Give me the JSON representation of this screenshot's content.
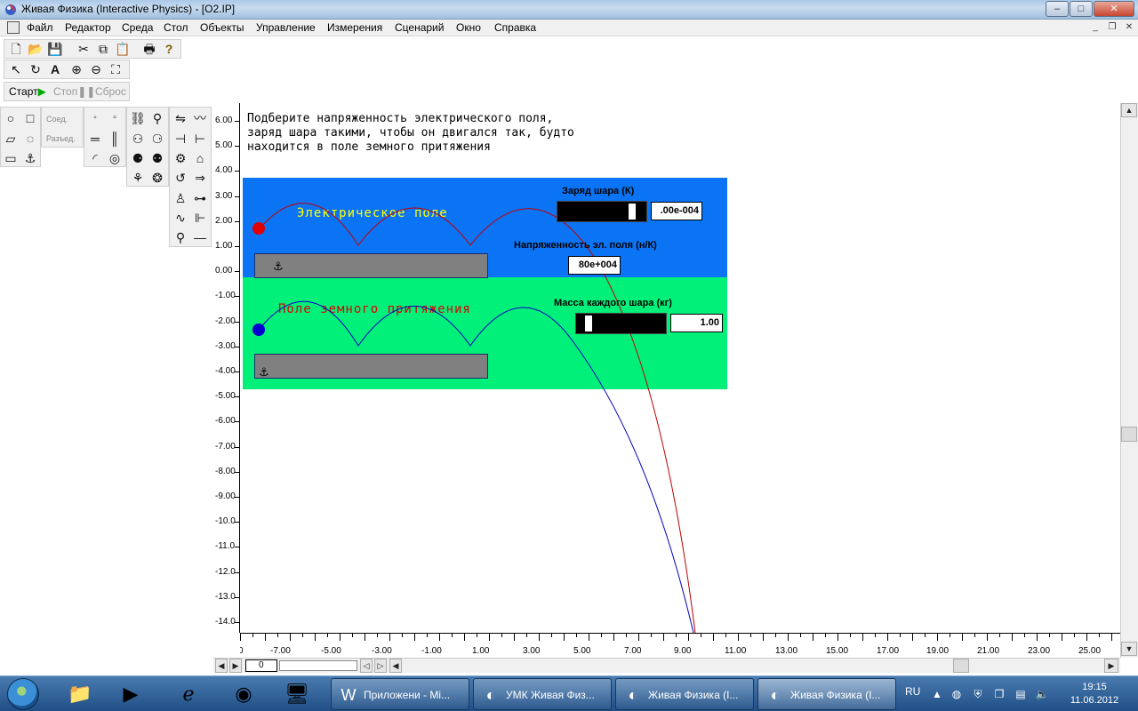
{
  "window": {
    "title": "Живая Физика (Interactive Physics) - [O2.IP]",
    "controls": {
      "minimize": "–",
      "maximize": "□",
      "close": "✕"
    }
  },
  "menubar": {
    "items": [
      "Файл",
      "Редактор",
      "Среда",
      "Стол",
      "Объекты",
      "Управление",
      "Измерения",
      "Сценарий",
      "Окно",
      "Справка"
    ],
    "mdi_controls": {
      "minimize": "_",
      "restore": "❐",
      "close": "✕"
    }
  },
  "controls": {
    "start": "Старт",
    "stop": "Стоп",
    "reset": "Сброс"
  },
  "palette": {
    "join": "Соед.",
    "split": "Разъед."
  },
  "canvas": {
    "instruction": [
      "Подберите напряженность электрического поля,",
      "заряд шара такими, чтобы он двигался так, будто",
      "находится в поле земного притяжения"
    ],
    "electric_field_label": "Электрическое поле",
    "gravity_field_label": "Поле земного притяжения",
    "charge": {
      "label": "Заряд шара (К)",
      "value": ".00e-004",
      "slider_fraction": 0.9
    },
    "field_strength": {
      "label": "Напряженность эл. поля (н/К)",
      "value": "80e+004"
    },
    "mass": {
      "label": "Масса каждого шара (кг)",
      "value": "1.00",
      "slider_fraction": 0.1
    },
    "colors": {
      "electric_panel": "#0a74f5",
      "gravity_panel": "#00f07a",
      "red_ball": "#e00000",
      "blue_ball": "#0000d0",
      "electric_label": "#ffff00",
      "gravity_label": "#e00000"
    },
    "y_ruler": [
      "6.00",
      "5.00",
      "4.00",
      "3.00",
      "2.00",
      "1.00",
      "0.00",
      "-1.00",
      "-2.00",
      "-3.00",
      "-4.00",
      "-5.00",
      "-6.00",
      "-7.00",
      "-8.00",
      "-9.00",
      "-10.0",
      "-11.0",
      "-12.0",
      "-13.0",
      "-14.0"
    ],
    "x_ruler": [
      "0",
      "-7.00",
      "-5.00",
      "-3.00",
      "-1.00",
      "1.00",
      "3.00",
      "5.00",
      "7.00",
      "9.00",
      "11.00",
      "13.00",
      "15.00",
      "17.00",
      "19.00",
      "21.00",
      "23.00",
      "25.00"
    ],
    "frame_counter": "0"
  },
  "taskbar": {
    "pinned": [
      "explorer-icon",
      "media-player-icon",
      "internet-explorer-icon",
      "chrome-icon",
      "remote-desktop-icon"
    ],
    "buttons": [
      {
        "label": "Приложени - Mi...",
        "icon": "word-icon"
      },
      {
        "label": "УМК Живая Физ...",
        "icon": "interactive-physics-icon"
      },
      {
        "label": "Живая Физика (I...",
        "icon": "interactive-physics-icon"
      },
      {
        "label": "Живая Физика (I...",
        "icon": "interactive-physics-icon"
      }
    ],
    "language": "RU",
    "time": "19:15",
    "date": "11.06.2012"
  }
}
